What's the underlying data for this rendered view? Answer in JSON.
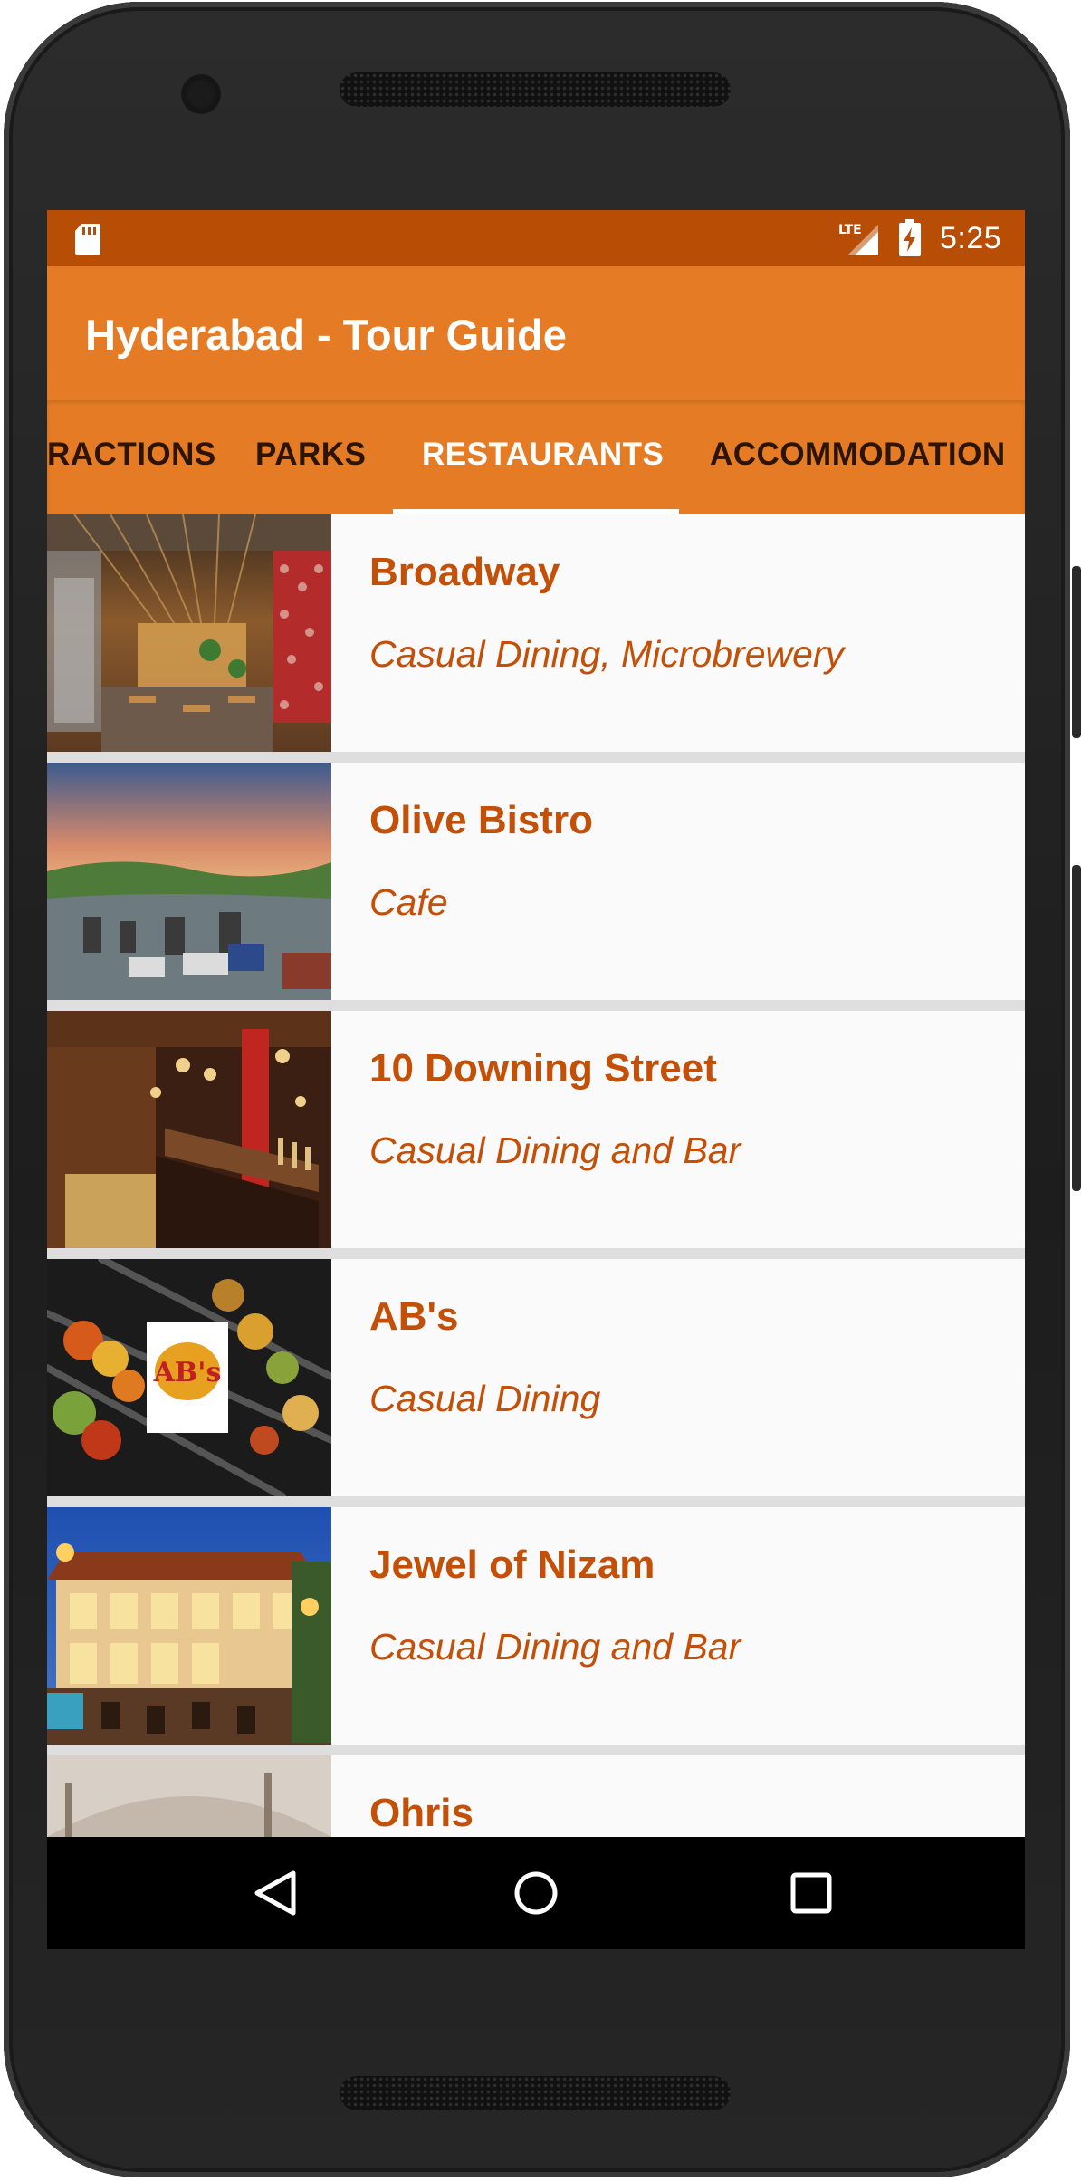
{
  "status_bar": {
    "time": "5:25",
    "network": "LTE"
  },
  "app_bar": {
    "title": "Hyderabad - Tour Guide"
  },
  "tabs": [
    {
      "label": "RACTIONS",
      "active": false
    },
    {
      "label": "PARKS",
      "active": false
    },
    {
      "label": "RESTAURANTS",
      "active": true
    },
    {
      "label": "ACCOMMODATION",
      "active": false
    }
  ],
  "restaurants": [
    {
      "name": "Broadway",
      "type": "Casual Dining, Microbrewery"
    },
    {
      "name": "Olive Bistro",
      "type": "Cafe"
    },
    {
      "name": "10 Downing Street",
      "type": "Casual Dining and Bar"
    },
    {
      "name": "AB's",
      "type": "Casual Dining"
    },
    {
      "name": "Jewel of Nizam",
      "type": "Casual Dining and Bar"
    },
    {
      "name": "Ohris",
      "type": ""
    }
  ],
  "thumb_logos": {
    "abs_logo_text": "AB's"
  },
  "colors": {
    "status_bar": "#b84d05",
    "primary": "#e57c25",
    "accent_text": "#c44f06",
    "tab_inactive_text": "#2b1500",
    "tab_active_text": "#ffffff"
  },
  "icons": {
    "status": [
      "sd-card-icon",
      "lte-signal-icon",
      "battery-charging-icon"
    ],
    "navigation": [
      "back-icon",
      "home-icon",
      "recents-icon"
    ]
  }
}
